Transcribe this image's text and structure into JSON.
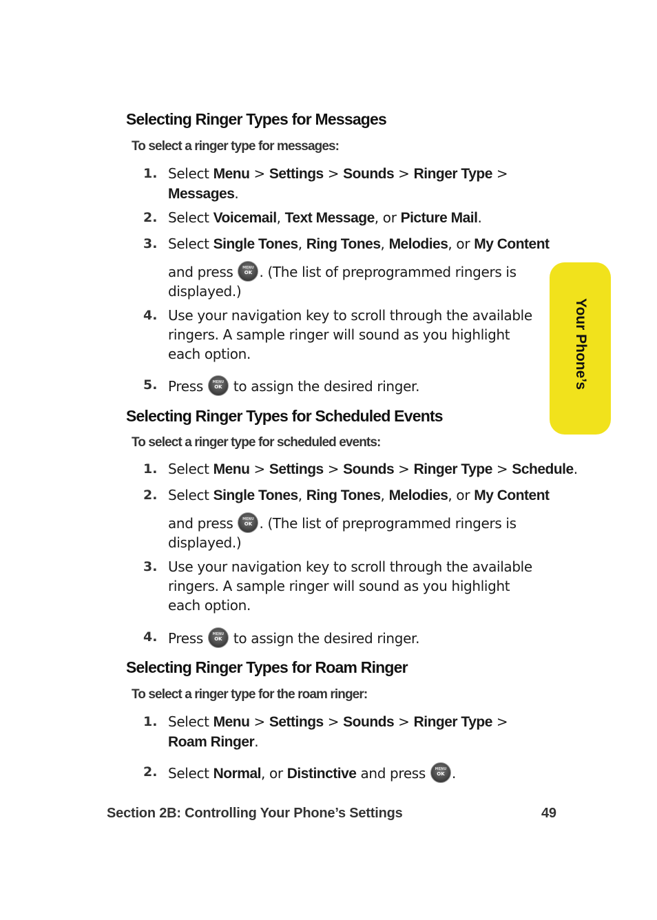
{
  "side_tab": {
    "label": "Your Phone’s",
    "color": "#f1e21c"
  },
  "ok_key": {
    "top": "MENU",
    "bottom": "OK"
  },
  "sections": [
    {
      "title": "Selecting Ringer Types for Messages",
      "intro": "To select a ringer type for messages:",
      "steps": [
        {
          "num": "1.",
          "lines": [
            [
              {
                "t": "Select "
              },
              {
                "b": "Menu"
              },
              {
                "t": " > "
              },
              {
                "b": "Settings"
              },
              {
                "t": " > "
              },
              {
                "b": "Sounds"
              },
              {
                "t": " > "
              },
              {
                "b": "Ringer Type"
              },
              {
                "t": " >"
              }
            ],
            [
              {
                "b": "Messages"
              },
              {
                "t": "."
              }
            ]
          ]
        },
        {
          "num": "2.",
          "lines": [
            [
              {
                "t": "Select "
              },
              {
                "b": "Voicemail"
              },
              {
                "t": ", "
              },
              {
                "b": "Text Message"
              },
              {
                "t": ", or "
              },
              {
                "b": "Picture Mail"
              },
              {
                "t": "."
              }
            ]
          ]
        },
        {
          "num": "3.",
          "lines": [
            [
              {
                "t": "Select "
              },
              {
                "b": "Single Tones"
              },
              {
                "t": ", "
              },
              {
                "b": "Ring Tones"
              },
              {
                "t": ", "
              },
              {
                "b": "Melodies"
              },
              {
                "t": ", or "
              },
              {
                "b": "My Content"
              }
            ],
            [
              {
                "t": "and press "
              },
              {
                "icon": "ok-key"
              },
              {
                "t": ". (The list of preprogrammed ringers is"
              }
            ],
            [
              {
                "t": "displayed.)"
              }
            ]
          ]
        },
        {
          "num": "4.",
          "lines": [
            [
              {
                "t": "Use your navigation key to scroll through the available"
              }
            ],
            [
              {
                "t": "ringers. A sample ringer will sound as you highlight"
              }
            ],
            [
              {
                "t": "each option."
              }
            ]
          ]
        },
        {
          "num": "5.",
          "lines": [
            [
              {
                "t": "Press "
              },
              {
                "icon": "ok-key"
              },
              {
                "t": " to assign the desired ringer."
              }
            ]
          ]
        }
      ]
    },
    {
      "title": "Selecting Ringer Types for Scheduled Events",
      "intro": "To select a ringer type for scheduled events:",
      "steps": [
        {
          "num": "1.",
          "lines": [
            [
              {
                "t": "Select "
              },
              {
                "b": "Menu"
              },
              {
                "t": " > "
              },
              {
                "b": "Settings"
              },
              {
                "t": " > "
              },
              {
                "b": "Sounds"
              },
              {
                "t": " > "
              },
              {
                "b": "Ringer Type"
              },
              {
                "t": " > "
              },
              {
                "b": "Schedule"
              },
              {
                "t": "."
              }
            ]
          ]
        },
        {
          "num": "2.",
          "lines": [
            [
              {
                "t": "Select "
              },
              {
                "b": "Single Tones"
              },
              {
                "t": ", "
              },
              {
                "b": "Ring Tones"
              },
              {
                "t": ", "
              },
              {
                "b": "Melodies"
              },
              {
                "t": ", or "
              },
              {
                "b": "My Content"
              }
            ],
            [
              {
                "t": "and press "
              },
              {
                "icon": "ok-key"
              },
              {
                "t": ". (The list of preprogrammed ringers is"
              }
            ],
            [
              {
                "t": "displayed.)"
              }
            ]
          ]
        },
        {
          "num": "3.",
          "lines": [
            [
              {
                "t": "Use your navigation key to scroll through the available"
              }
            ],
            [
              {
                "t": "ringers. A sample ringer will sound as you highlight"
              }
            ],
            [
              {
                "t": "each option."
              }
            ]
          ]
        },
        {
          "num": "4.",
          "lines": [
            [
              {
                "t": "Press "
              },
              {
                "icon": "ok-key"
              },
              {
                "t": " to assign the desired ringer."
              }
            ]
          ]
        }
      ]
    },
    {
      "title": "Selecting Ringer Types for Roam Ringer",
      "intro": "To select a ringer type for the roam ringer:",
      "steps": [
        {
          "num": "1.",
          "lines": [
            [
              {
                "t": "Select "
              },
              {
                "b": "Menu"
              },
              {
                "t": " > "
              },
              {
                "b": "Settings"
              },
              {
                "t": " > "
              },
              {
                "b": "Sounds"
              },
              {
                "t": " > "
              },
              {
                "b": "Ringer Type"
              },
              {
                "t": " >"
              }
            ],
            [
              {
                "b": "Roam Ringer"
              },
              {
                "t": "."
              }
            ]
          ]
        },
        {
          "num": "2.",
          "lines": [
            [
              {
                "t": "Select "
              },
              {
                "b": "Normal"
              },
              {
                "t": ", or "
              },
              {
                "b": "Distinctive"
              },
              {
                "t": " and press "
              },
              {
                "icon": "ok-key"
              },
              {
                "t": "."
              }
            ]
          ]
        }
      ]
    }
  ],
  "footer": {
    "section_label": "Section 2B: Controlling Your Phone’s Settings",
    "page_number": "49"
  }
}
